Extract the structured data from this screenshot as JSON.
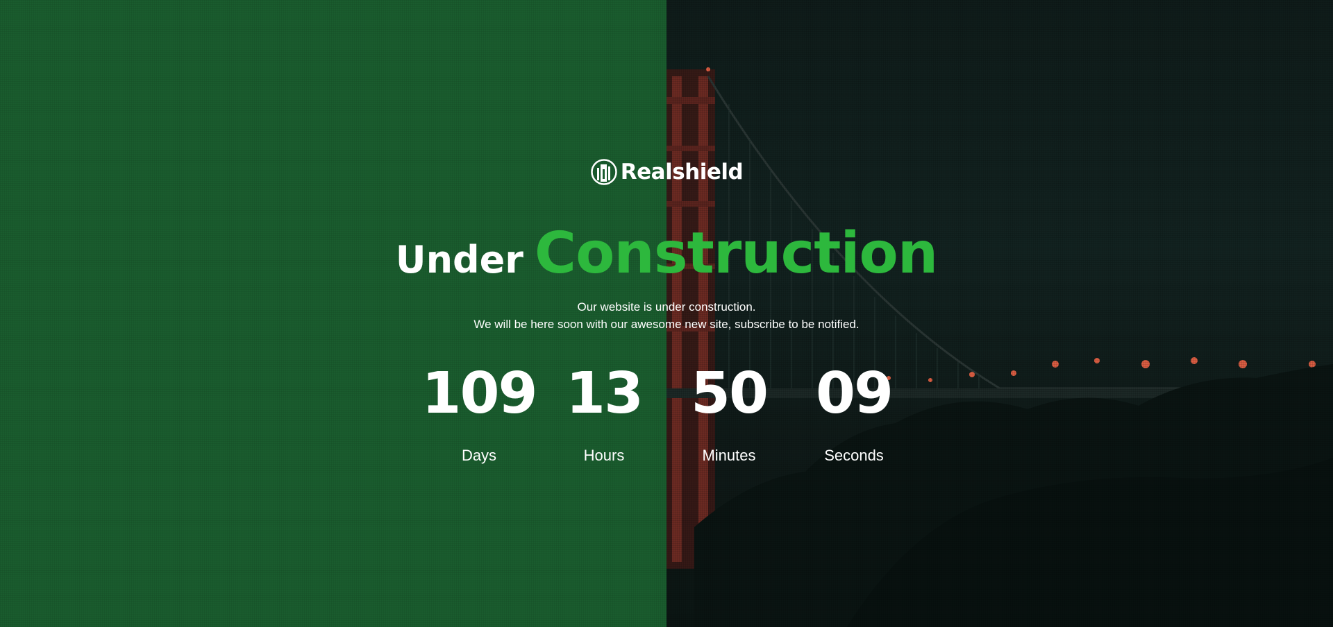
{
  "brand": {
    "name": "Realshield",
    "logo_icon": "shield-tower-icon"
  },
  "headline": {
    "prefix": "Under",
    "highlight": "Construction",
    "highlight_color": "#2db83d"
  },
  "message": {
    "line1": "Our website is under construction.",
    "line2": "We will be here soon with our awesome new site, subscribe to be notified."
  },
  "countdown": [
    {
      "value": "109",
      "label": "Days"
    },
    {
      "value": "13",
      "label": "Hours"
    },
    {
      "value": "50",
      "label": "Minutes"
    },
    {
      "value": "09",
      "label": "Seconds"
    }
  ],
  "colors": {
    "left_panel": "#1a5c2e",
    "right_panel": "#0f1c1a",
    "accent": "#2db83d",
    "text": "#ffffff"
  }
}
